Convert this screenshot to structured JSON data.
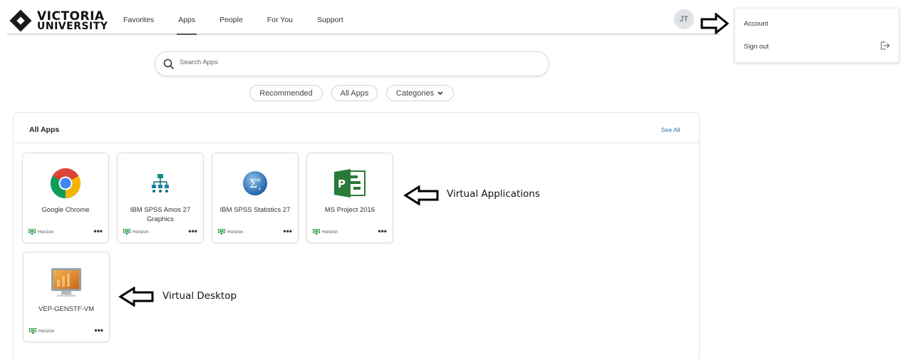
{
  "logo": {
    "line1": "VICTORIA",
    "line2": "UNIVERSITY"
  },
  "nav": {
    "items": [
      {
        "label": "Favorites"
      },
      {
        "label": "Apps"
      },
      {
        "label": "People"
      },
      {
        "label": "For You"
      },
      {
        "label": "Support"
      }
    ],
    "active": "Apps"
  },
  "user": {
    "initials": "JT"
  },
  "account_menu": {
    "account": "Account",
    "sign_out": "Sign out"
  },
  "search": {
    "placeholder": "Search Apps"
  },
  "filters": {
    "recommended": "Recommended",
    "all_apps": "All Apps",
    "categories": "Categories"
  },
  "section": {
    "title": "All Apps",
    "see_all": "See All"
  },
  "apps": [
    {
      "name": "Google Chrome",
      "source": "Horizon",
      "icon": "chrome-icon"
    },
    {
      "name": "IBM SPSS Amos 27 Graphics",
      "source": "Horizon",
      "icon": "spss-amos-icon"
    },
    {
      "name": "IBM SPSS Statistics 27",
      "source": "Horizon",
      "icon": "spss-statistics-icon"
    },
    {
      "name": "MS Project 2016",
      "source": "Horizon",
      "icon": "ms-project-icon"
    },
    {
      "name": "VEP-GENSTF-VM",
      "source": "Horizon",
      "icon": "virtual-desktop-icon"
    }
  ],
  "annotations": {
    "virtual_applications": "Virtual Applications",
    "virtual_desktop": "Virtual Desktop"
  },
  "colors": {
    "link": "#2d6fb5",
    "horizon_green": "#2e9b4a",
    "project_green": "#2b7a3a"
  }
}
